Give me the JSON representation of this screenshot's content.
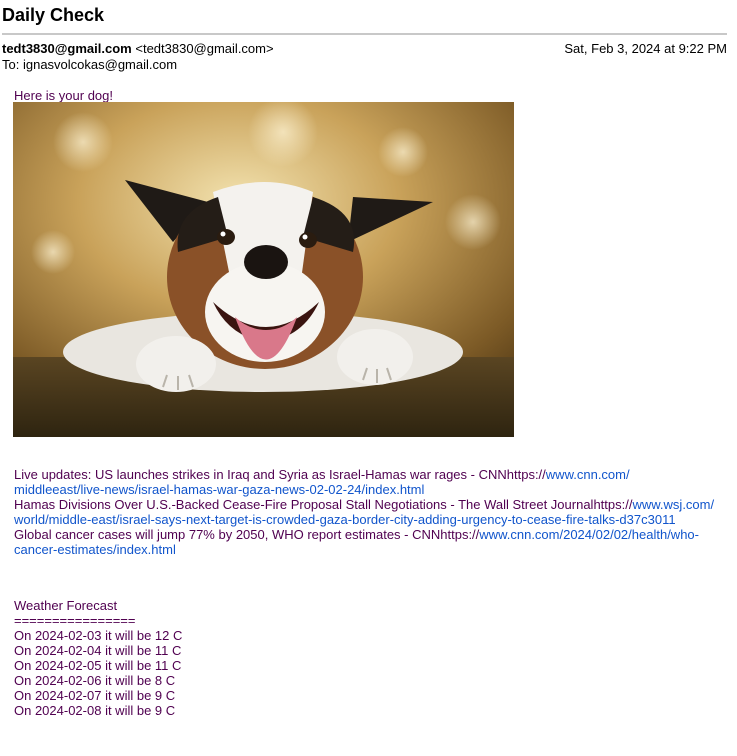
{
  "email": {
    "subject": "Daily Check",
    "from_name": "tedt3830@gmail.com",
    "from_address": "<tedt3830@gmail.com>",
    "date": "Sat, Feb 3, 2024 at 9:22 PM",
    "to_prefix": "To: ",
    "to_address": "ignasvolcokas@gmail.com"
  },
  "body": {
    "greeting": "Here is your dog!",
    "image_alt": "dog photo",
    "news": [
      {
        "title": "Live updates: US launches strikes in Iraq and Syria as Israel-Hamas war rages - CNN",
        "url_prefix": "https://",
        "url_link": "www.cnn.com/",
        "url_rest": "middleeast/live-news/israel-hamas-war-gaza-news-02-02-24/index.html"
      },
      {
        "title": "Hamas Divisions Over U.S.-Backed Cease-Fire Proposal Stall Negotiations - The Wall Street Journal",
        "url_prefix": "https://",
        "url_link": "www.wsj.com/",
        "url_rest": "world/middle-east/israel-says-next-target-is-crowded-gaza-border-city-adding-urgency-to-cease-fire-talks-d37c3011"
      },
      {
        "title": "Global cancer cases will jump 77% by 2050, WHO report estimates - CNN",
        "url_prefix": "https://",
        "url_link": "www.cnn.com/2024/02/02/health/who-",
        "url_rest": "cancer-estimates/index.html"
      }
    ],
    "weather_title": "Weather Forecast",
    "weather_rule": "================",
    "forecast": [
      "On 2024-02-03 it will be 12 C",
      "On 2024-02-04 it will be 11 C",
      "On 2024-02-05 it will be 11 C",
      "On 2024-02-06 it will be 8 C",
      "On 2024-02-07 it will be 9 C",
      "On 2024-02-08 it will be 9 C"
    ]
  }
}
